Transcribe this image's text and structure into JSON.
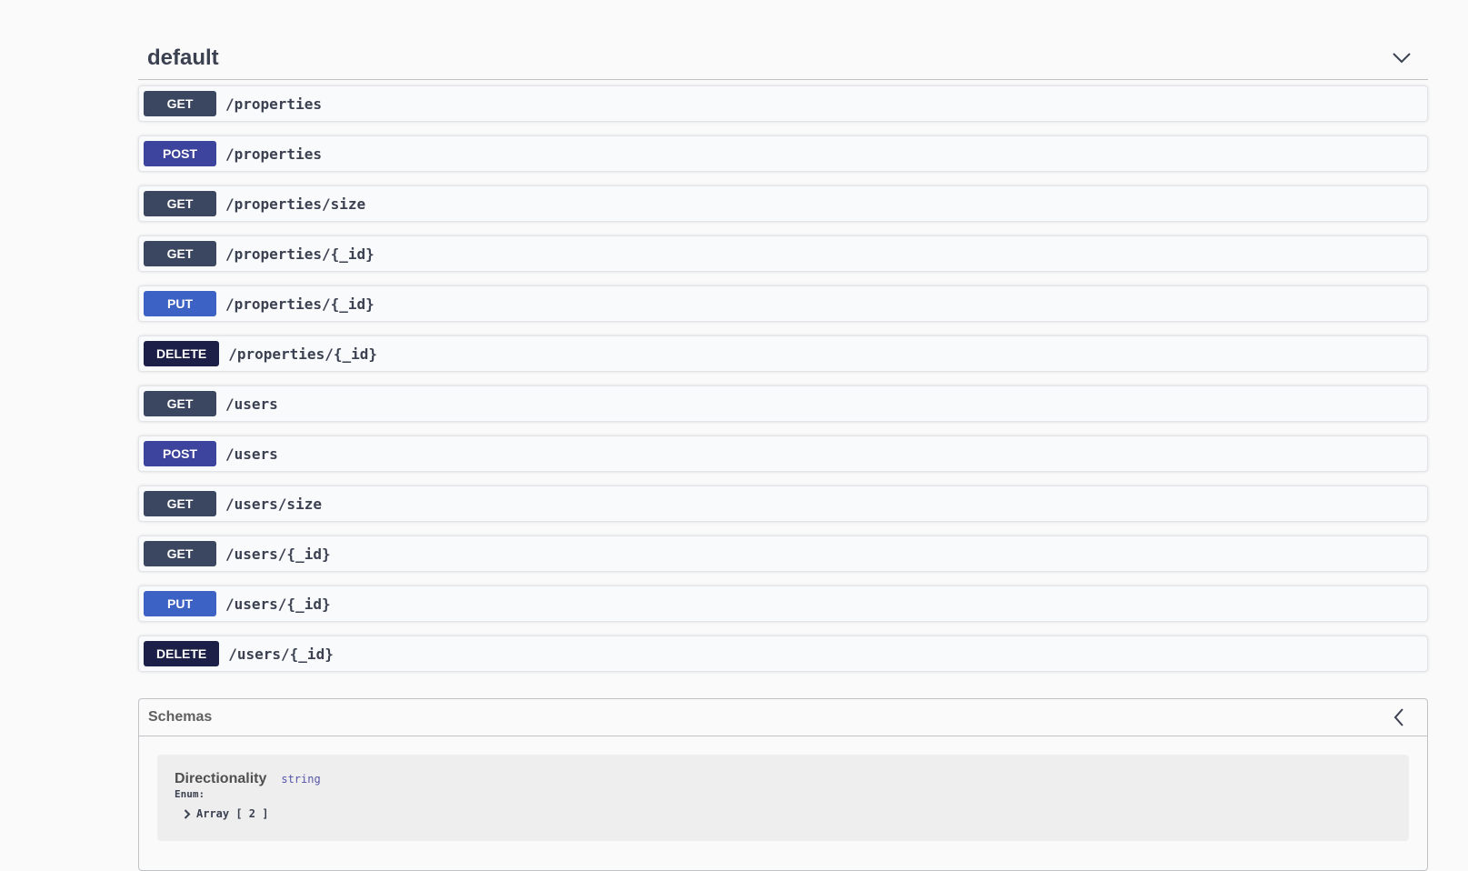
{
  "tag": {
    "title": "default",
    "toggle_icon": "chevron-down-icon"
  },
  "operations": [
    {
      "method": "GET",
      "path": "/properties",
      "color": "#3b4660"
    },
    {
      "method": "POST",
      "path": "/properties",
      "color": "#3d449d"
    },
    {
      "method": "GET",
      "path": "/properties/size",
      "color": "#3b4660"
    },
    {
      "method": "GET",
      "path": "/properties/{_id}",
      "color": "#3b4660"
    },
    {
      "method": "PUT",
      "path": "/properties/{_id}",
      "color": "#3b62c4"
    },
    {
      "method": "DELETE",
      "path": "/properties/{_id}",
      "color": "#1c2048"
    },
    {
      "method": "GET",
      "path": "/users",
      "color": "#3b4660"
    },
    {
      "method": "POST",
      "path": "/users",
      "color": "#3d449d"
    },
    {
      "method": "GET",
      "path": "/users/size",
      "color": "#3b4660"
    },
    {
      "method": "GET",
      "path": "/users/{_id}",
      "color": "#3b4660"
    },
    {
      "method": "PUT",
      "path": "/users/{_id}",
      "color": "#3b62c4"
    },
    {
      "method": "DELETE",
      "path": "/users/{_id}",
      "color": "#1c2048"
    }
  ],
  "schemas": {
    "title": "Schemas",
    "toggle_icon": "chevron-left-icon",
    "models": [
      {
        "name": "Directionality",
        "type": "string",
        "enum_label": "Enum:",
        "array_label": "Array [ 2 ]"
      }
    ]
  }
}
